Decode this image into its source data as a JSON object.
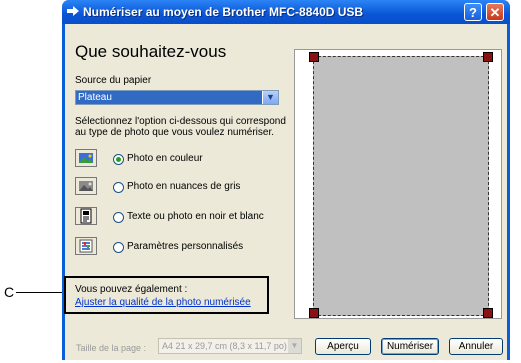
{
  "window": {
    "title": "Numériser au moyen de Brother MFC-8840D USB",
    "help_glyph": "?",
    "close_glyph": "✕"
  },
  "main": {
    "heading": "Que souhaitez-vous",
    "paper_source_label": "Source du papier",
    "paper_source_value": "Plateau",
    "description": "Sélectionnez l'option ci-dessous qui correspond au type de photo que vous voulez numériser.",
    "options": [
      {
        "label": "Photo en couleur",
        "selected": true,
        "icon": "color-photo-icon"
      },
      {
        "label": "Photo en nuances de gris",
        "selected": false,
        "icon": "grayscale-photo-icon"
      },
      {
        "label": "Texte ou photo en noir et blanc",
        "selected": false,
        "icon": "black-white-text-icon"
      },
      {
        "label": "Paramètres personnalisés",
        "selected": false,
        "icon": "custom-settings-icon"
      }
    ],
    "also_label": "Vous pouvez également :",
    "adjust_link": "Ajuster la qualité de la photo numérisée"
  },
  "footer": {
    "page_size_label": "Taille de la page :",
    "page_size_value": "A4 21 x 29,7 cm (8,3 x 11,7 po)",
    "preview_button": "Aperçu",
    "scan_button": "Numériser",
    "cancel_button": "Annuler"
  },
  "callout": {
    "letter": "C"
  },
  "colors": {
    "titlebar": "#0a55d6",
    "window_bg": "#ece9d8",
    "link": "#0033cc",
    "selection": "#316ac5"
  }
}
